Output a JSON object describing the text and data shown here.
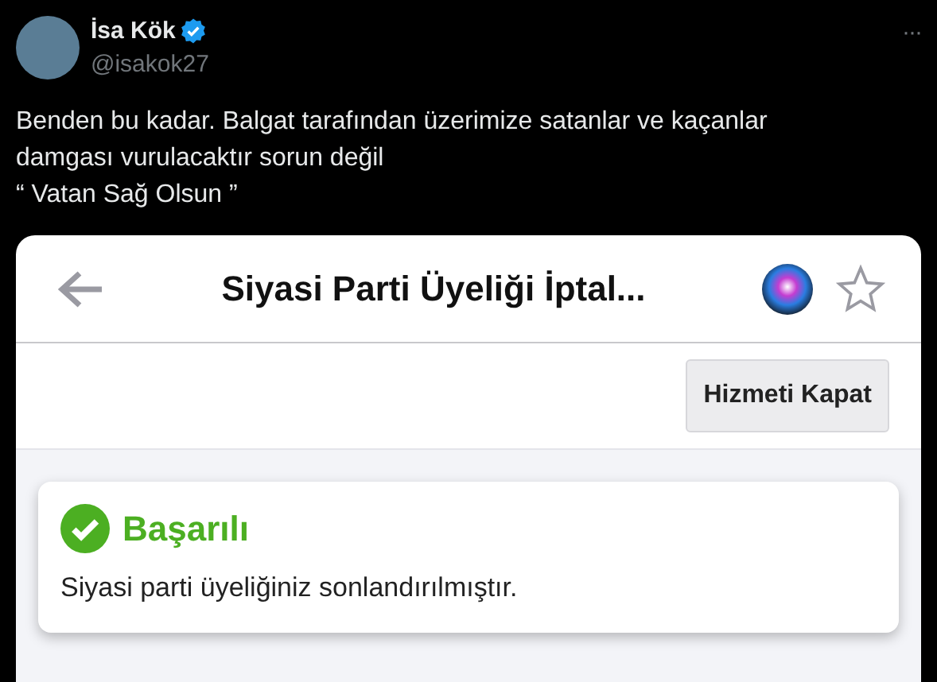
{
  "tweet": {
    "author": "İsa Kök",
    "verified": true,
    "handle": "@isakok27",
    "more": "···",
    "text": "Benden bu kadar. Balgat tarafından üzerimize satanlar ve kaçanlar\ndamgası vurulacaktır sorun değil\n“ Vatan Sağ Olsun ”"
  },
  "embedded_screen": {
    "title": "Siyasi Parti Üyeliği İptal...",
    "starred": false,
    "button": "Hizmeti Kapat",
    "alert": {
      "kind": "success",
      "title": "Başarılı",
      "message": "Siyasi parti üyeliğiniz sonlandırılmıştır."
    }
  }
}
